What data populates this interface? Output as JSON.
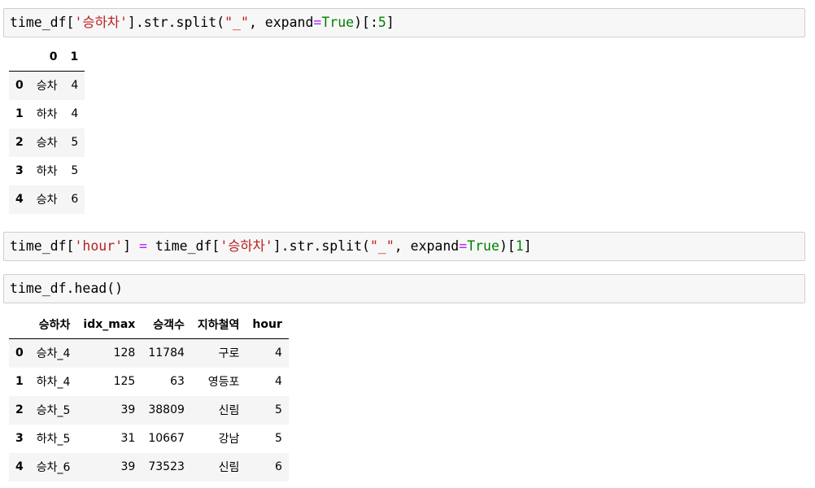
{
  "cells": [
    {
      "tokens": [
        {
          "t": "time_df[",
          "c": ""
        },
        {
          "t": "'승하차'",
          "c": "str"
        },
        {
          "t": "].str.split(",
          "c": ""
        },
        {
          "t": "\"_\"",
          "c": "str"
        },
        {
          "t": ", expand",
          "c": ""
        },
        {
          "t": "=",
          "c": "op"
        },
        {
          "t": "True",
          "c": "kw"
        },
        {
          "t": ")[:",
          "c": ""
        },
        {
          "t": "5",
          "c": "num"
        },
        {
          "t": "]",
          "c": ""
        }
      ]
    },
    {
      "tokens": [
        {
          "t": "time_df[",
          "c": ""
        },
        {
          "t": "'hour'",
          "c": "str"
        },
        {
          "t": "] ",
          "c": ""
        },
        {
          "t": "=",
          "c": "op"
        },
        {
          "t": " time_df[",
          "c": ""
        },
        {
          "t": "'승하차'",
          "c": "str"
        },
        {
          "t": "].str.split(",
          "c": ""
        },
        {
          "t": "\"_\"",
          "c": "str"
        },
        {
          "t": ", expand",
          "c": ""
        },
        {
          "t": "=",
          "c": "op"
        },
        {
          "t": "True",
          "c": "kw"
        },
        {
          "t": ")[",
          "c": ""
        },
        {
          "t": "1",
          "c": "num"
        },
        {
          "t": "]",
          "c": ""
        }
      ]
    },
    {
      "tokens": [
        {
          "t": "time_df.head()",
          "c": ""
        }
      ]
    }
  ],
  "table1": {
    "columns": [
      "",
      "0",
      "1"
    ],
    "rows": [
      [
        "0",
        "승차",
        "4"
      ],
      [
        "1",
        "하차",
        "4"
      ],
      [
        "2",
        "승차",
        "5"
      ],
      [
        "3",
        "하차",
        "5"
      ],
      [
        "4",
        "승차",
        "6"
      ]
    ]
  },
  "table2": {
    "columns": [
      "",
      "승하차",
      "idx_max",
      "승객수",
      "지하철역",
      "hour"
    ],
    "rows": [
      [
        "0",
        "승차_4",
        "128",
        "11784",
        "구로",
        "4"
      ],
      [
        "1",
        "하차_4",
        "125",
        "63",
        "영등포",
        "4"
      ],
      [
        "2",
        "승차_5",
        "39",
        "38809",
        "신림",
        "5"
      ],
      [
        "3",
        "하차_5",
        "31",
        "10667",
        "강남",
        "5"
      ],
      [
        "4",
        "승차_6",
        "39",
        "73523",
        "신림",
        "6"
      ]
    ]
  }
}
